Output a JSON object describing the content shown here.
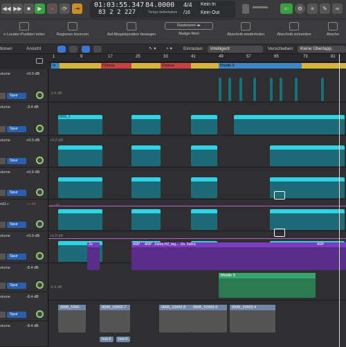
{
  "transport": {
    "time": "01:03:55.347",
    "tempo": "84.0000",
    "sig_top": "4/4",
    "bars": "83  2  2  227",
    "tempo_label": "Tempo beibehalten",
    "sig_bottom": "/16",
    "in": "Kein In",
    "out": "Kein Out"
  },
  "toolbar": {
    "loop": "n Locator-Punkten teilen",
    "bounce": "Regionen bouncen",
    "playpos": "Auf Abspielposition bewegen",
    "nudge_value": "Rasterwert",
    "nudge": "Nudge-Wert",
    "repeat": "Abschnitt wiederholen",
    "cut": "Abschnitt schneiden",
    "insert": "Abschn"
  },
  "controls": {
    "functions": "tionen",
    "view": "Ansicht",
    "snap_label": "Einrasten:",
    "snap_value": "Intelligent",
    "move_label": "Verschieben:",
    "move_value": "Keine Überlapp."
  },
  "ruler": [
    "1",
    "9",
    "17",
    "25",
    "33",
    "41",
    "49",
    "57",
    "65",
    "73",
    "81"
  ],
  "markers": [
    {
      "label": "In"
    },
    {
      "label": "Chorus"
    },
    {
      "label": "Chorus"
    },
    {
      "label": "Middle 8"
    }
  ],
  "tracks": [
    {
      "vol": "olume",
      "db": "+0.0 dB",
      "name": ""
    },
    {
      "vol": "olume",
      "db": "-3.4 dB",
      "name": "Spur"
    },
    {
      "vol": "olume",
      "db": "+0.0 dB",
      "name": "Spur"
    },
    {
      "vol": "olume",
      "db": "+0.0 dB",
      "name": "Spur"
    },
    {
      "vol": "nd1-r",
      "db": "-∞ dB",
      "name": "Spur"
    },
    {
      "vol": "olume",
      "db": "+0.0 dB",
      "name": "Spur"
    },
    {
      "vol": "olume",
      "db": "-8.4 dB",
      "name": "Spur"
    },
    {
      "vol": "olume",
      "db": "-8.4 dB",
      "name": "Spur"
    },
    {
      "vol": "olume",
      "db": "-8.4 dB",
      "name": "Spur"
    }
  ],
  "lane_labels": {
    "l1": "-3.4 dB",
    "l2": "+0.0 dB",
    "l3": "-∞ dB",
    "l4": "+0.0 dB",
    "l5": "-8.4 dB"
  },
  "regions": {
    "arp1": "ARP",
    "zebra": "Zebra HZ_big...",
    "za": "Za",
    "ze": "Ze",
    "zebra2": "Zebra",
    "arp2": "ARP",
    "arp3": "ARP",
    "middle9": "Middle 9",
    "audio1": "0006_10#0",
    "audio2": "0006_10#02.7",
    "audio3": "0006_10#02.8",
    "audio4": "0006_10#03.9",
    "audio5": "0006_10#03.4",
    "inst1": "Inst 6",
    "inst2": "Inst 6",
    "cyan0": "0006_1"
  },
  "colors": {
    "cyan": "#2fd3e6",
    "yellow": "#d7b43a",
    "red": "#c94040",
    "blue": "#3a86c9",
    "purple": "#7a3dbf",
    "green": "#37a46d"
  }
}
